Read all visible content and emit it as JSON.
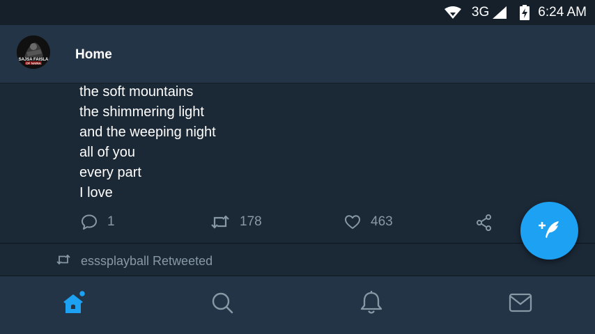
{
  "status_bar": {
    "network": "3G",
    "time": "6:24 AM"
  },
  "header": {
    "title": "Home",
    "avatar_text_line1": "SAJSA FAISLA",
    "avatar_text_line2": "OF NAINA"
  },
  "tweet": {
    "lines": [
      "the soft mountains",
      "the shimmering light",
      "and the weeping night",
      "all of you",
      "every part",
      "I love"
    ],
    "reply_count": "1",
    "retweet_count": "178",
    "like_count": "463"
  },
  "retweet_context": {
    "text": "esssplayball Retweeted"
  },
  "icons": {
    "wifi": "wifi-icon",
    "signal": "cell-signal-icon",
    "battery": "battery-charging-icon",
    "reply": "reply-icon",
    "retweet": "retweet-icon",
    "like": "heart-icon",
    "share": "share-icon",
    "compose": "compose-tweet-icon",
    "home": "home-icon",
    "search": "search-icon",
    "notifications": "bell-icon",
    "messages": "mail-icon"
  },
  "colors": {
    "background": "#1b2836",
    "header": "#243447",
    "status_bar": "#15202b",
    "accent": "#1da1f2",
    "muted_text": "#8899a6"
  }
}
